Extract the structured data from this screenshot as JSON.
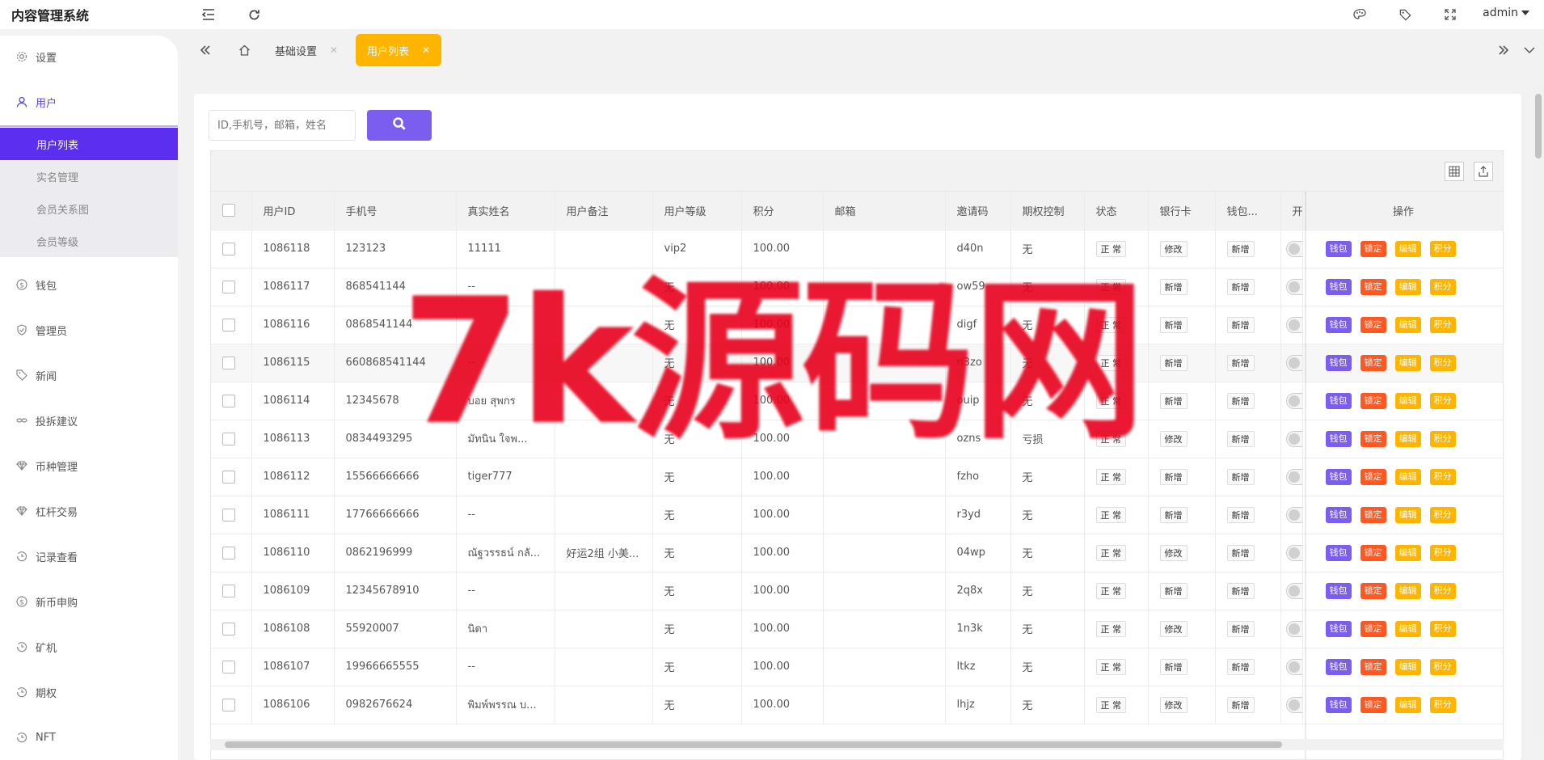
{
  "app": {
    "title": "内容管理系统",
    "user": "admin"
  },
  "sidebar": {
    "items": [
      {
        "label": "设置",
        "icon": "gear-icon"
      },
      {
        "label": "用户",
        "icon": "user-icon"
      },
      {
        "label": "钱包",
        "icon": "dollar-icon"
      },
      {
        "label": "管理员",
        "icon": "shield-icon"
      },
      {
        "label": "新闻",
        "icon": "tag-icon"
      },
      {
        "label": "投拆建议",
        "icon": "link-icon"
      },
      {
        "label": "币种管理",
        "icon": "diamond-icon"
      },
      {
        "label": "杠杆交易",
        "icon": "diamond-icon"
      },
      {
        "label": "记录查看",
        "icon": "history-icon"
      },
      {
        "label": "新币申购",
        "icon": "dollar-icon"
      },
      {
        "label": "矿机",
        "icon": "history-icon"
      },
      {
        "label": "期权",
        "icon": "history-icon"
      },
      {
        "label": "NFT",
        "icon": "history-icon"
      }
    ],
    "user_sub": [
      "用户列表",
      "实名管理",
      "会员关系图",
      "会员等级"
    ]
  },
  "tabs": [
    {
      "label": "基础设置"
    },
    {
      "label": "用户列表"
    }
  ],
  "search": {
    "placeholder": "ID,手机号，邮箱，姓名"
  },
  "table": {
    "columns": [
      "用户ID",
      "手机号",
      "真实姓名",
      "用户备注",
      "用户等级",
      "积分",
      "邮箱",
      "邀请码",
      "期权控制",
      "状态",
      "银行卡",
      "钱包...",
      "开",
      "操作"
    ],
    "ops": [
      "钱包",
      "锁定",
      "编辑",
      "积分"
    ],
    "rows": [
      {
        "id": "1086118",
        "phone": "123123",
        "name": "11111",
        "note": "",
        "level": "vip2",
        "points": "100.00",
        "email": "",
        "code": "d40n",
        "ctrl": "无",
        "status": "正 常",
        "bank": "修改",
        "wallet": "新增"
      },
      {
        "id": "1086117",
        "phone": "868541144",
        "name": "--",
        "note": "",
        "level": "无",
        "points": "100.00",
        "email": "",
        "code": "ow59",
        "ctrl": "无",
        "status": "正 常",
        "bank": "新增",
        "wallet": "新增"
      },
      {
        "id": "1086116",
        "phone": "0868541144",
        "name": "",
        "note": "",
        "level": "无",
        "points": "100.00",
        "email": "",
        "code": "digf",
        "ctrl": "无",
        "status": "正 常",
        "bank": "新增",
        "wallet": "新增"
      },
      {
        "id": "1086115",
        "phone": "660868541144",
        "name": "--",
        "note": "",
        "level": "无",
        "points": "100.00",
        "email": "",
        "code": "n3zo",
        "ctrl": "无",
        "status": "正 常",
        "bank": "新增",
        "wallet": "新增"
      },
      {
        "id": "1086114",
        "phone": "12345678",
        "name": "บอย สุพกร",
        "note": "",
        "level": "无",
        "points": "100.00",
        "email": "",
        "code": "ouip",
        "ctrl": "无",
        "status": "正 常",
        "bank": "新增",
        "wallet": "新增"
      },
      {
        "id": "1086113",
        "phone": "0834493295",
        "name": "มัทนิน ใจพ...",
        "note": "",
        "level": "无",
        "points": "100.00",
        "email": "",
        "code": "ozns",
        "ctrl": "亏损",
        "status": "正 常",
        "bank": "修改",
        "wallet": "新增"
      },
      {
        "id": "1086112",
        "phone": "15566666666",
        "name": "tiger777",
        "note": "",
        "level": "无",
        "points": "100.00",
        "email": "",
        "code": "fzho",
        "ctrl": "无",
        "status": "正 常",
        "bank": "新增",
        "wallet": "新增"
      },
      {
        "id": "1086111",
        "phone": "17766666666",
        "name": "--",
        "note": "",
        "level": "无",
        "points": "100.00",
        "email": "",
        "code": "r3yd",
        "ctrl": "无",
        "status": "正 常",
        "bank": "新增",
        "wallet": "新增"
      },
      {
        "id": "1086110",
        "phone": "0862196999",
        "name": "ณัฐวรรธน์ กลั...",
        "note": "好运2组 小美...",
        "level": "无",
        "points": "100.00",
        "email": "",
        "code": "04wp",
        "ctrl": "无",
        "status": "正 常",
        "bank": "修改",
        "wallet": "新增"
      },
      {
        "id": "1086109",
        "phone": "12345678910",
        "name": "--",
        "note": "",
        "level": "无",
        "points": "100.00",
        "email": "",
        "code": "2q8x",
        "ctrl": "无",
        "status": "正 常",
        "bank": "新增",
        "wallet": "新增"
      },
      {
        "id": "1086108",
        "phone": "55920007",
        "name": "นิดา",
        "note": "",
        "level": "无",
        "points": "100.00",
        "email": "",
        "code": "1n3k",
        "ctrl": "无",
        "status": "正 常",
        "bank": "修改",
        "wallet": "新增"
      },
      {
        "id": "1086107",
        "phone": "19966665555",
        "name": "--",
        "note": "",
        "level": "无",
        "points": "100.00",
        "email": "",
        "code": "ltkz",
        "ctrl": "无",
        "status": "正 常",
        "bank": "新增",
        "wallet": "新增"
      },
      {
        "id": "1086106",
        "phone": "0982676624",
        "name": "พิมพ์พรรณ บ...",
        "note": "",
        "level": "无",
        "points": "100.00",
        "email": "",
        "code": "lhjz",
        "ctrl": "无",
        "status": "正 常",
        "bank": "修改",
        "wallet": "新增"
      }
    ]
  },
  "watermark": "7k源码网",
  "colors": {
    "accent": "#7b5df0",
    "active_nav": "#5b2ef0",
    "active_tab": "#ffb400",
    "danger": "#ff5722",
    "watermark": "#e8001c"
  }
}
